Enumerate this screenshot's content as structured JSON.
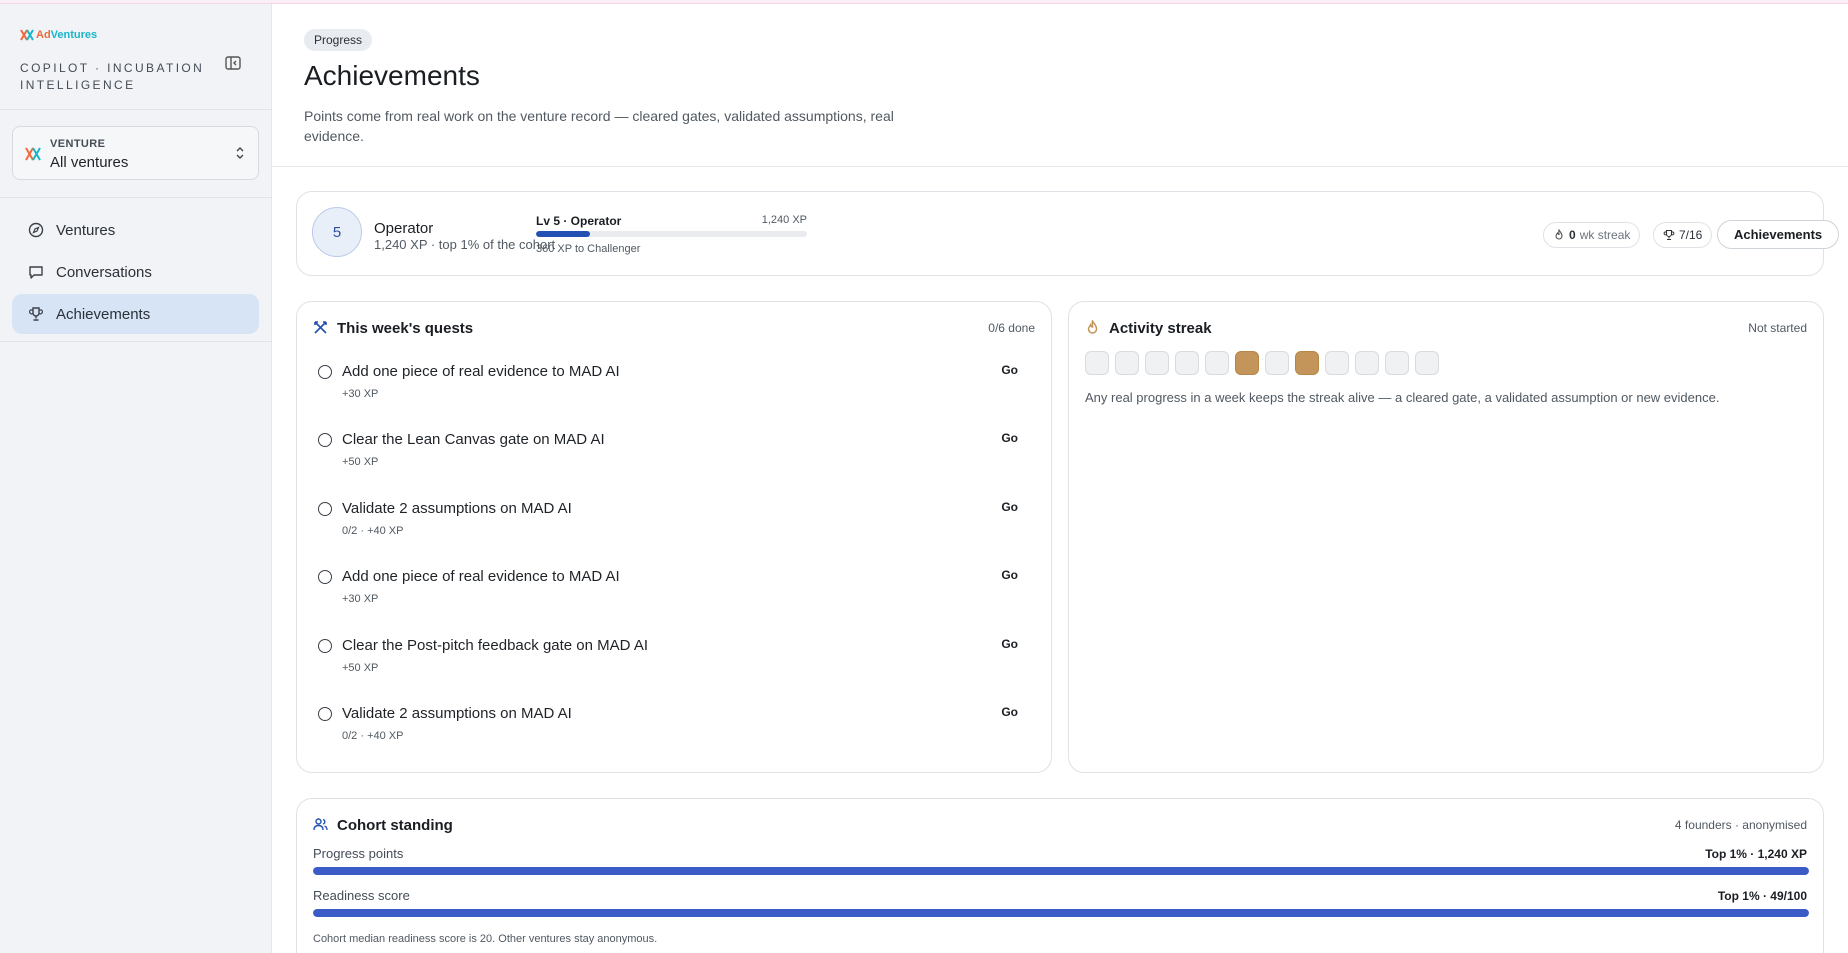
{
  "brand": {
    "name_part1": "Ad",
    "name_part2": "Ventures",
    "tagline": "COPILOT · INCUBATION INTELLIGENCE"
  },
  "venture_select": {
    "label": "VENTURE",
    "value": "All ventures"
  },
  "nav": [
    {
      "label": "Ventures",
      "icon": "compass-icon",
      "active": false
    },
    {
      "label": "Conversations",
      "icon": "chat-icon",
      "active": false
    },
    {
      "label": "Achievements",
      "icon": "trophy-icon",
      "active": true
    }
  ],
  "page": {
    "badge": "Progress",
    "title": "Achievements",
    "description": "Points come from real work on the venture record — cleared gates, validated assumptions, real evidence."
  },
  "level": {
    "number": "5",
    "name": "Operator",
    "subtitle": "1,240 XP · top 1% of the cohort",
    "bar_title": "Lv 5 · Operator",
    "bar_xp": "1,240 XP",
    "progress_fraction": 0.2,
    "next": "360 XP to Challenger",
    "streak_count": "0",
    "streak_suffix": "wk streak",
    "trophies": "7/16",
    "button_label": "Achievements"
  },
  "quests": {
    "title": "This week's quests",
    "meta": "0/6 done",
    "items": [
      {
        "title": "Add one piece of real evidence to MAD AI",
        "meta": "+30 XP",
        "action": "Go"
      },
      {
        "title": "Clear the Lean Canvas gate on MAD AI",
        "meta": "+50 XP",
        "action": "Go"
      },
      {
        "title": "Validate 2 assumptions on MAD AI",
        "meta": "0/2 · +40 XP",
        "action": "Go"
      },
      {
        "title": "Add one piece of real evidence to MAD AI",
        "meta": "+30 XP",
        "action": "Go"
      },
      {
        "title": "Clear the Post-pitch feedback gate on MAD AI",
        "meta": "+50 XP",
        "action": "Go"
      },
      {
        "title": "Validate 2 assumptions on MAD AI",
        "meta": "0/2 · +40 XP",
        "action": "Go"
      }
    ]
  },
  "streak": {
    "title": "Activity streak",
    "status": "Not started",
    "weeks": [
      false,
      false,
      false,
      false,
      false,
      true,
      false,
      true,
      false,
      false,
      false,
      false
    ],
    "note": "Any real progress in a week keeps the streak alive — a cleared gate, a validated assumption or new evidence."
  },
  "cohort": {
    "title": "Cohort standing",
    "meta": "4 founders · anonymised",
    "metrics": [
      {
        "label": "Progress points",
        "value": "Top 1% · 1,240 XP",
        "fraction": 1.0
      },
      {
        "label": "Readiness score",
        "value": "Top 1% · 49/100",
        "fraction": 1.0
      }
    ],
    "note": "Cohort median readiness score is 20. Other ventures stay anonymous."
  },
  "colors": {
    "accent": "#2351b3",
    "streak_on": "#c4955a",
    "active_nav": "#d6e4f6"
  }
}
